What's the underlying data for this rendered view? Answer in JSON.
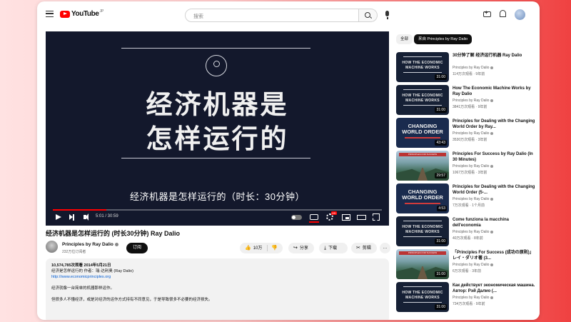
{
  "header": {
    "logo_text": "YouTube",
    "logo_suffix": "JP",
    "search_placeholder": "搜索"
  },
  "player": {
    "title_line1": "经济机器是",
    "title_line2": "怎样运行的",
    "subtitle": "经济机器是怎样运行的（时长：30分钟）",
    "time": "5:01 / 30:59",
    "progress": 0.162,
    "hd_badge": "HD"
  },
  "video": {
    "title": "经济机器是怎样运行的 (时长30分钟) Ray Dalio",
    "channel": "Principles by Ray Dalio",
    "subscribers": "232万位订阅者",
    "subscribe": "订阅",
    "likes": "10万",
    "share": "分享",
    "download": "下载",
    "clip": "剪辑",
    "more": "…"
  },
  "description": {
    "stats": "10,574,785次观看  2014年5月21日",
    "line1": "经济运行如同机器",
    "line1b": "经济是怎样运行的  作者：瑞·达利奥 (Ray Dalio)",
    "link": "http://www.economicprinciples.org",
    "line2": "经济就像一台简单的机器那样运作。",
    "line3": "但很多人不懂经济，或是对经济的运作方式持有不同意见，于是导致很多不必要的经济损失。"
  },
  "chips": {
    "all": "全部",
    "from": "来自 Principles by Ray Dalio"
  },
  "recommendations": [
    {
      "title": "30分钟了解 经济运行机器 Ray Dalio",
      "channel": "Principles by Ray Dalio",
      "meta": "114万次观看 · 9年前",
      "duration": "31:00",
      "thumb_text": "HOW THE ECONOMIC MACHINE WORKS",
      "thumb_kind": "econ"
    },
    {
      "title": "How The Economic Machine Works by Ray Dalio",
      "channel": "Principles by Ray Dalio",
      "meta": "3841万次观看 · 9年前",
      "duration": "31:00",
      "thumb_text": "HOW THE ECONOMIC MACHINE WORKS",
      "thumb_kind": "econ"
    },
    {
      "title": "Principles for Dealing with the Changing World Order by Ray...",
      "channel": "Principles by Ray Dalio",
      "meta": "3530万次观看 · 3年前",
      "duration": "43:43",
      "thumb_text": "CHANGING WORLD ORDER",
      "thumb_kind": "world"
    },
    {
      "title": "Principles For Success by Ray Dalio (In 30 Minutes)",
      "channel": "Principles by Ray Dalio",
      "meta": "1067万次观看 · 3年前",
      "duration": "29:57",
      "thumb_text": "PRINCIPLES FOR SUCCESS",
      "thumb_kind": "scen"
    },
    {
      "title": "Principles for Dealing with the Changing World Order (5-...",
      "channel": "Principles by Ray Dalio",
      "meta": "7万次观看 · 1个月前",
      "duration": "4:53",
      "thumb_text": "CHANGING WORLD ORDER",
      "thumb_kind": "world"
    },
    {
      "title": "Come funziona la macchina dell'economia",
      "channel": "Principles by Ray Dalio",
      "meta": "40万次观看 · 8年前",
      "duration": "31:00",
      "thumb_text": "HOW THE ECONOMIC MACHINE WORKS",
      "thumb_kind": "econ"
    },
    {
      "title": "「Principles For Success (成功の原則)」レイ・ダリオ著 (3...",
      "channel": "Principles by Ray Dalio",
      "meta": "6万次观看 · 3年前",
      "duration": "31:00",
      "thumb_text": "PRINCIPLES FOR SUCCESS",
      "thumb_kind": "scen"
    },
    {
      "title": "Как действует экономическая машина. Автор: Рэй Далио (...",
      "channel": "Principles by Ray Dalio",
      "meta": "734万次观看 · 9年前",
      "duration": "31:00",
      "thumb_text": "HOW THE ECONOMIC MACHINE WORKS",
      "thumb_kind": "econ"
    }
  ]
}
